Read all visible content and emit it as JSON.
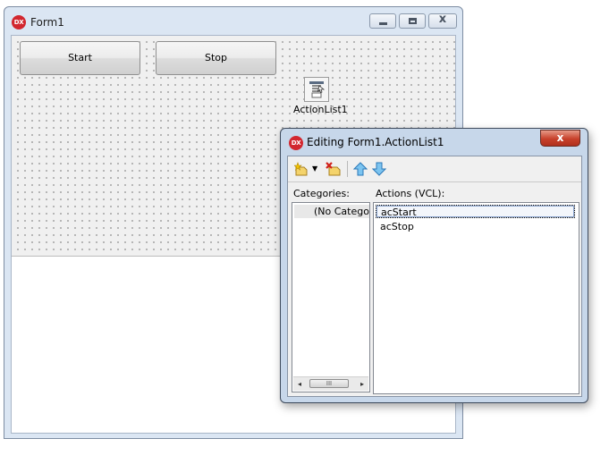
{
  "form": {
    "title": "Form1",
    "logo": "DX",
    "caption_buttons": [
      "minimize-icon",
      "maximize-icon",
      "close-icon"
    ],
    "buttons": {
      "start": "Start",
      "stop": "Stop"
    },
    "component": {
      "icon": "action-list-icon",
      "label": "ActionList1"
    }
  },
  "editor": {
    "title": "Editing Form1.ActionList1",
    "logo": "DX",
    "close_glyph": "x",
    "toolbar": [
      "new-action-icon",
      "dropdown-arrow-icon",
      "delete-action-icon",
      "move-up-icon",
      "move-down-icon"
    ],
    "categories_label": "Categories:",
    "actions_label": "Actions (VCL):",
    "categories": [
      "(No Category)"
    ],
    "actions": [
      "acStart",
      "acStop"
    ],
    "selected_action": "acStart",
    "scrollbar": {
      "left": "◂",
      "right": "▸",
      "thumb": "III"
    }
  },
  "colors": {
    "logo_red": "#d2272f",
    "close_red": "#c7412b",
    "frame_blue": "#c7d7ea"
  }
}
